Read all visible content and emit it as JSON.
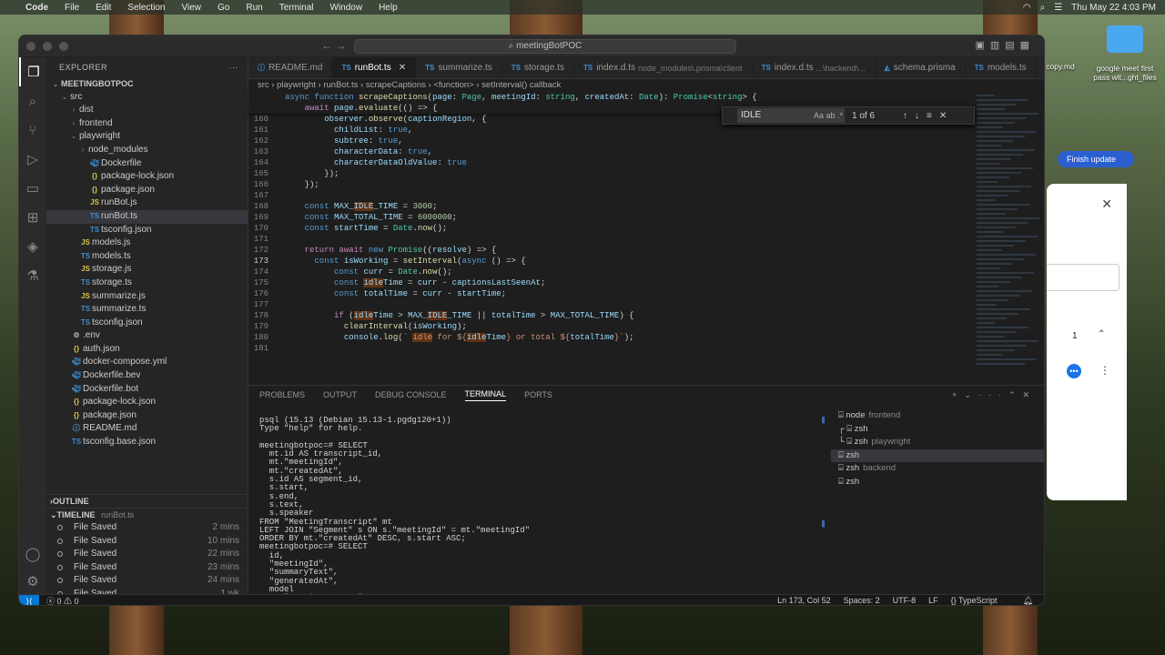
{
  "menubar": {
    "app": "Code",
    "items": [
      "File",
      "Edit",
      "Selection",
      "View",
      "Go",
      "Run",
      "Terminal",
      "Window",
      "Help"
    ],
    "clock": "Thu May 22  4:03 PM"
  },
  "titlebar": {
    "search": "meetingBotPOC"
  },
  "explorer": {
    "title": "EXPLORER",
    "root": "MEETINGBOTPOC",
    "tree": [
      {
        "label": "src",
        "depth": 1,
        "kind": "folder-open"
      },
      {
        "label": "dist",
        "depth": 2,
        "kind": "folder"
      },
      {
        "label": "frontend",
        "depth": 2,
        "kind": "folder"
      },
      {
        "label": "playwright",
        "depth": 2,
        "kind": "folder-open"
      },
      {
        "label": "node_modules",
        "depth": 3,
        "kind": "folder"
      },
      {
        "label": "Dockerfile",
        "depth": 3,
        "kind": "docker"
      },
      {
        "label": "package-lock.json",
        "depth": 3,
        "kind": "json"
      },
      {
        "label": "package.json",
        "depth": 3,
        "kind": "json"
      },
      {
        "label": "runBot.js",
        "depth": 3,
        "kind": "js"
      },
      {
        "label": "runBot.ts",
        "depth": 3,
        "kind": "ts",
        "selected": true
      },
      {
        "label": "tsconfig.json",
        "depth": 3,
        "kind": "tsconfig"
      },
      {
        "label": "models.js",
        "depth": 2,
        "kind": "js"
      },
      {
        "label": "models.ts",
        "depth": 2,
        "kind": "ts"
      },
      {
        "label": "storage.js",
        "depth": 2,
        "kind": "js"
      },
      {
        "label": "storage.ts",
        "depth": 2,
        "kind": "ts"
      },
      {
        "label": "summarize.js",
        "depth": 2,
        "kind": "js"
      },
      {
        "label": "summarize.ts",
        "depth": 2,
        "kind": "ts"
      },
      {
        "label": "tsconfig.json",
        "depth": 2,
        "kind": "tsconfig"
      },
      {
        "label": ".env",
        "depth": 1,
        "kind": "env"
      },
      {
        "label": "auth.json",
        "depth": 1,
        "kind": "json"
      },
      {
        "label": "docker-compose.yml",
        "depth": 1,
        "kind": "docker"
      },
      {
        "label": "Dockerfile.bev",
        "depth": 1,
        "kind": "docker"
      },
      {
        "label": "Dockerfile.bot",
        "depth": 1,
        "kind": "docker"
      },
      {
        "label": "package-lock.json",
        "depth": 1,
        "kind": "json"
      },
      {
        "label": "package.json",
        "depth": 1,
        "kind": "json"
      },
      {
        "label": "README.md",
        "depth": 1,
        "kind": "md"
      },
      {
        "label": "tsconfig.base.json",
        "depth": 1,
        "kind": "tsconfig"
      }
    ],
    "outline_label": "OUTLINE",
    "timeline_label": "TIMELINE",
    "timeline_file": "runBot.ts",
    "timeline": [
      {
        "t": "File Saved",
        "ago": "2 mins"
      },
      {
        "t": "File Saved",
        "ago": "10 mins"
      },
      {
        "t": "File Saved",
        "ago": "22 mins"
      },
      {
        "t": "File Saved",
        "ago": "23 mins"
      },
      {
        "t": "File Saved",
        "ago": "24 mins"
      },
      {
        "t": "File Saved",
        "ago": "1 wk"
      },
      {
        "t": "File Saved",
        "ago": ""
      },
      {
        "t": "File Saved",
        "ago": ""
      }
    ]
  },
  "tabs": [
    {
      "label": "README.md",
      "icon": "info-icon"
    },
    {
      "label": "runBot.ts",
      "icon": "ts",
      "active": true
    },
    {
      "label": "summarize.ts",
      "icon": "ts"
    },
    {
      "label": "storage.ts",
      "icon": "ts"
    },
    {
      "label": "index.d.ts",
      "sub": "node_modules\\.prisma\\client",
      "icon": "ts"
    },
    {
      "label": "index.d.ts",
      "sub": "...\\backend\\...",
      "icon": "ts"
    },
    {
      "label": "schema.prisma",
      "icon": "prisma"
    },
    {
      "label": "models.ts",
      "icon": "ts"
    }
  ],
  "breadcrumb": [
    "src",
    "playwright",
    "runBot.ts",
    "scrapeCaptions",
    "<function>",
    "setInterval() callback"
  ],
  "find": {
    "query": "IDLE",
    "count": "1 of 6",
    "options": "Aa ab .*"
  },
  "code": [
    {
      "n": "",
      "h": "<span class='kw'>async</span> <span class='kw'>function</span> <span class='fn'>scrapeCaptions</span>(<span class='var'>page</span>: <span class='ty'>Page</span>, <span class='var'>meetingId</span>: <span class='ty'>string</span>, <span class='var'>createdAt</span>: <span class='ty'>Date</span>): <span class='ty'>Promise</span>&lt;<span class='ty'>string</span>&gt; {",
      "top": true
    },
    {
      "n": "",
      "h": "    <span class='kw2'>await</span> <span class='var'>page</span>.<span class='fn'>evaluate</span>(() =&gt; {",
      "top": true
    },
    {
      "n": "160",
      "h": "        <span class='var'>observer</span>.<span class='fn'>observe</span>(<span class='var'>captionRegion</span>, {"
    },
    {
      "n": "161",
      "h": "          <span class='var'>childList</span>: <span class='kw'>true</span>,"
    },
    {
      "n": "162",
      "h": "          <span class='var'>subtree</span>: <span class='kw'>true</span>,"
    },
    {
      "n": "163",
      "h": "          <span class='var'>characterData</span>: <span class='kw'>true</span>,"
    },
    {
      "n": "164",
      "h": "          <span class='var'>characterDataOldValue</span>: <span class='kw'>true</span>"
    },
    {
      "n": "165",
      "h": "        });"
    },
    {
      "n": "166",
      "h": "    });"
    },
    {
      "n": "167",
      "h": ""
    },
    {
      "n": "168",
      "h": "    <span class='kw'>const</span> <span class='var'>MAX_<span class='hl'>IDLE</span>_TIME</span> = <span class='num2'>3000</span>;"
    },
    {
      "n": "169",
      "h": "    <span class='kw'>const</span> <span class='var'>MAX_TOTAL_TIME</span> = <span class='num2'>6000000</span>;"
    },
    {
      "n": "170",
      "h": "    <span class='kw'>const</span> <span class='var'>startTime</span> = <span class='ty'>Date</span>.<span class='fn'>now</span>();"
    },
    {
      "n": "171",
      "h": ""
    },
    {
      "n": "172",
      "h": "    <span class='kw2'>return</span> <span class='kw2'>await</span> <span class='kw'>new</span> <span class='ty'>Promise</span>((<span class='var'>resolve</span>) =&gt; {"
    },
    {
      "n": "173",
      "h": "      <span class='kw'>const</span> <span class='var'>isWorking</span> = <span class='fn'>setInterval</span>(<span class='kw'>async</span> () =&gt; {",
      "cur": true
    },
    {
      "n": "174",
      "h": "          <span class='kw'>const</span> <span class='var'>curr</span> = <span class='ty'>Date</span>.<span class='fn'>now</span>();"
    },
    {
      "n": "175",
      "h": "          <span class='kw'>const</span> <span class='var'><span class='hl'>idle</span>Time</span> = <span class='var'>curr</span> - <span class='var'>captionsLastSeenAt</span>;"
    },
    {
      "n": "176",
      "h": "          <span class='kw'>const</span> <span class='var'>totalTime</span> = <span class='var'>curr</span> - <span class='var'>startTime</span>;"
    },
    {
      "n": "177",
      "h": ""
    },
    {
      "n": "178",
      "h": "          <span class='kw2'>if</span> (<span class='var'><span class='hl'>idle</span>Time</span> &gt; <span class='var'>MAX_<span class='hl'>IDLE</span>_TIME</span> || <span class='var'>totalTime</span> &gt; <span class='var'>MAX_TOTAL_TIME</span>) {"
    },
    {
      "n": "179",
      "h": "            <span class='fn'>clearInterval</span>(<span class='var'>isWorking</span>);"
    },
    {
      "n": "180",
      "h": "            <span class='var'>console</span>.<span class='fn'>log</span>(<span class='str'>` <span class='hl'>idle</span> for ${</span><span class='var'><span class='hl'>idle</span>Time</span><span class='str'>} or total ${</span><span class='var'>totalTime</span><span class='str'>}`</span>);"
    },
    {
      "n": "181",
      "h": ""
    }
  ],
  "panel": {
    "tabs": [
      "PROBLEMS",
      "OUTPUT",
      "DEBUG CONSOLE",
      "TERMINAL",
      "PORTS"
    ],
    "active": "TERMINAL",
    "terminal_text": "psql (15.13 (Debian 15.13-1.pgdg120+1))\nType \"help\" for help.\n\nmeetingbotpoc=# SELECT\n  mt.id AS transcript_id,\n  mt.\"meetingId\",\n  mt.\"createdAt\",\n  s.id AS segment_id,\n  s.start,\n  s.end,\n  s.text,\n  s.speaker\nFROM \"MeetingTranscript\" mt\nLEFT JOIN \"Segment\" s ON s.\"meetingId\" = mt.\"meetingId\"\nORDER BY mt.\"createdAt\" DESC, s.start ASC;\nmeetingbotpoc=# SELECT\n  id,\n  \"meetingId\",\n  \"summaryText\",\n  \"generatedAt\",\n  model\nFROM \"MeetingSummary\"\nORDER BY \"generatedAt\" DESC;\nmeetingbotpoc=# exit\nmaggieveltri@Mac meetingBotPOC % ▯",
    "terminals": [
      {
        "name": "node",
        "sub": "frontend",
        "prefix": ""
      },
      {
        "name": "zsh",
        "sub": "",
        "prefix": "┌"
      },
      {
        "name": "zsh",
        "sub": "playwright",
        "prefix": "└"
      },
      {
        "name": "zsh",
        "sub": "",
        "prefix": "",
        "selected": true
      },
      {
        "name": "zsh",
        "sub": "backend",
        "prefix": ""
      },
      {
        "name": "zsh",
        "sub": "",
        "prefix": ""
      }
    ]
  },
  "status": {
    "problems": "0 ⚠ 0",
    "position": "Ln 173, Col 52",
    "spaces": "Spaces: 2",
    "encoding": "UTF-8",
    "eol": "LF",
    "lang": "TypeScript"
  },
  "desktop": {
    "file1": "copy.md",
    "file2": "google meet first pass wit...ght_files",
    "finish": "Finish update",
    "counter": "1"
  }
}
